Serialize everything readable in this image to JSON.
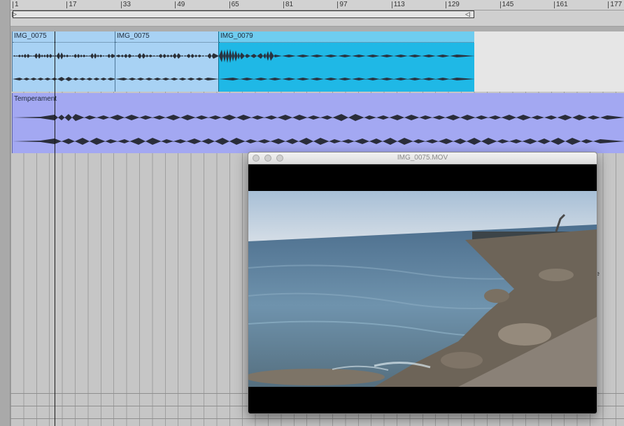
{
  "ruler": {
    "bars": [
      "1",
      "17",
      "33",
      "49",
      "65",
      "81",
      "97",
      "113",
      "129",
      "145",
      "161",
      "177"
    ]
  },
  "tracks": {
    "clips_track1": [
      {
        "name": "IMG_0075",
        "color": "#a8d2f4"
      },
      {
        "name": "IMG_0075",
        "color": "#a8d2f4"
      },
      {
        "name": "IMG_0079",
        "color": "#1fb8e6"
      }
    ],
    "track2_clip": {
      "name": "Temperament",
      "color": "#a3a8f2"
    }
  },
  "video_window": {
    "title": "IMG_0075.MOV"
  },
  "edge_label": "e",
  "colors": {
    "accent_clip": "#1fb8e6",
    "audio_clip": "#a8d2f4",
    "lavender_clip": "#a3a8f2",
    "background": "#c6c6c6"
  }
}
